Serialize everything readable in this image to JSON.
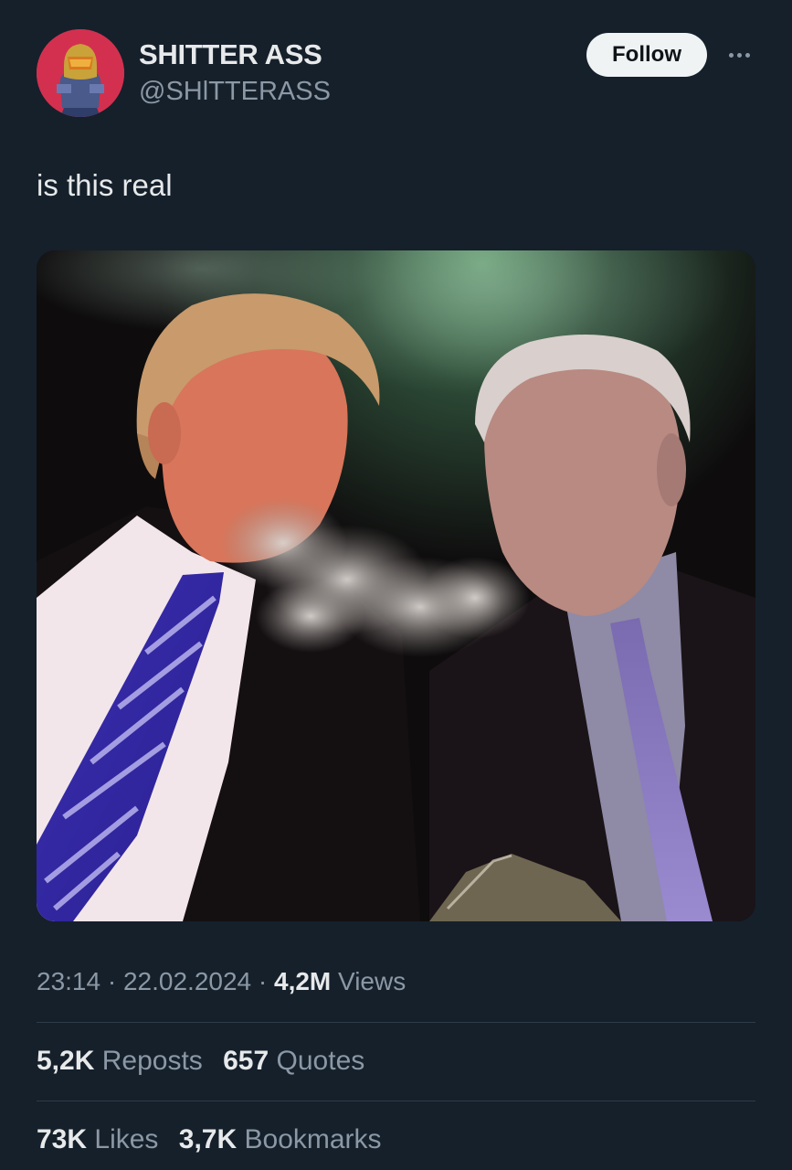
{
  "author": {
    "name": "SHITTER ASS",
    "handle": "@SHlTTERASS"
  },
  "actions": {
    "follow_label": "Follow"
  },
  "tweet": {
    "text": "is this real",
    "time": "23:14",
    "date": "22.02.2024",
    "views_count": "4,2M",
    "views_label": "Views"
  },
  "stats": {
    "reposts_count": "5,2K",
    "reposts_label": "Reposts",
    "quotes_count": "657",
    "quotes_label": "Quotes",
    "likes_count": "73K",
    "likes_label": "Likes",
    "bookmarks_count": "3,7K",
    "bookmarks_label": "Bookmarks"
  },
  "colors": {
    "background": "#15202b",
    "text_primary": "#e7e9ea",
    "text_secondary": "#8b98a5",
    "follow_button_bg": "#eff3f4",
    "avatar_bg": "#d3304f"
  },
  "icons": {
    "more": "more-dots-icon"
  }
}
